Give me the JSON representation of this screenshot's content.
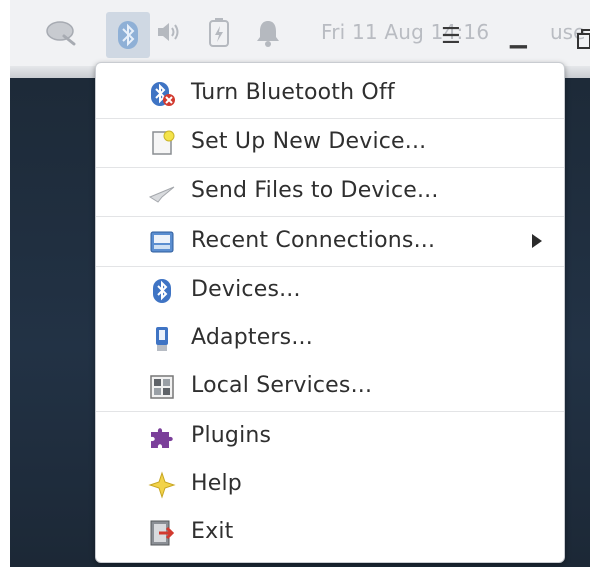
{
  "panel": {
    "clock": "Fri 11 Aug 14:16",
    "user": "use",
    "tray_icons": [
      "network-icon",
      "bluetooth-icon",
      "volume-icon",
      "battery-icon",
      "notification-bell-icon"
    ]
  },
  "menu": {
    "items": [
      {
        "label": "Turn Bluetooth Off",
        "icon": "bluetooth-off-icon"
      },
      {
        "label": "Set Up New Device...",
        "icon": "new-device-icon"
      },
      {
        "label": "Send Files to Device...",
        "icon": "send-files-icon"
      },
      {
        "label": "Recent Connections...",
        "icon": "recent-connections-icon",
        "has_submenu": true
      },
      {
        "label": "Devices...",
        "icon": "bluetooth-devices-icon"
      },
      {
        "label": "Adapters...",
        "icon": "adapter-icon"
      },
      {
        "label": "Local Services...",
        "icon": "local-services-icon"
      },
      {
        "label": "Plugins",
        "icon": "plugin-puzzle-icon"
      },
      {
        "label": "Help",
        "icon": "help-star-icon"
      },
      {
        "label": "Exit",
        "icon": "exit-icon"
      }
    ]
  },
  "colors": {
    "panel_bg": "#f1f2f4",
    "menu_bg": "#ffffff",
    "desktop_bg": "#1f2d3d",
    "bluetooth_blue": "#3f74c4",
    "plugin_purple": "#7b3f9a"
  }
}
